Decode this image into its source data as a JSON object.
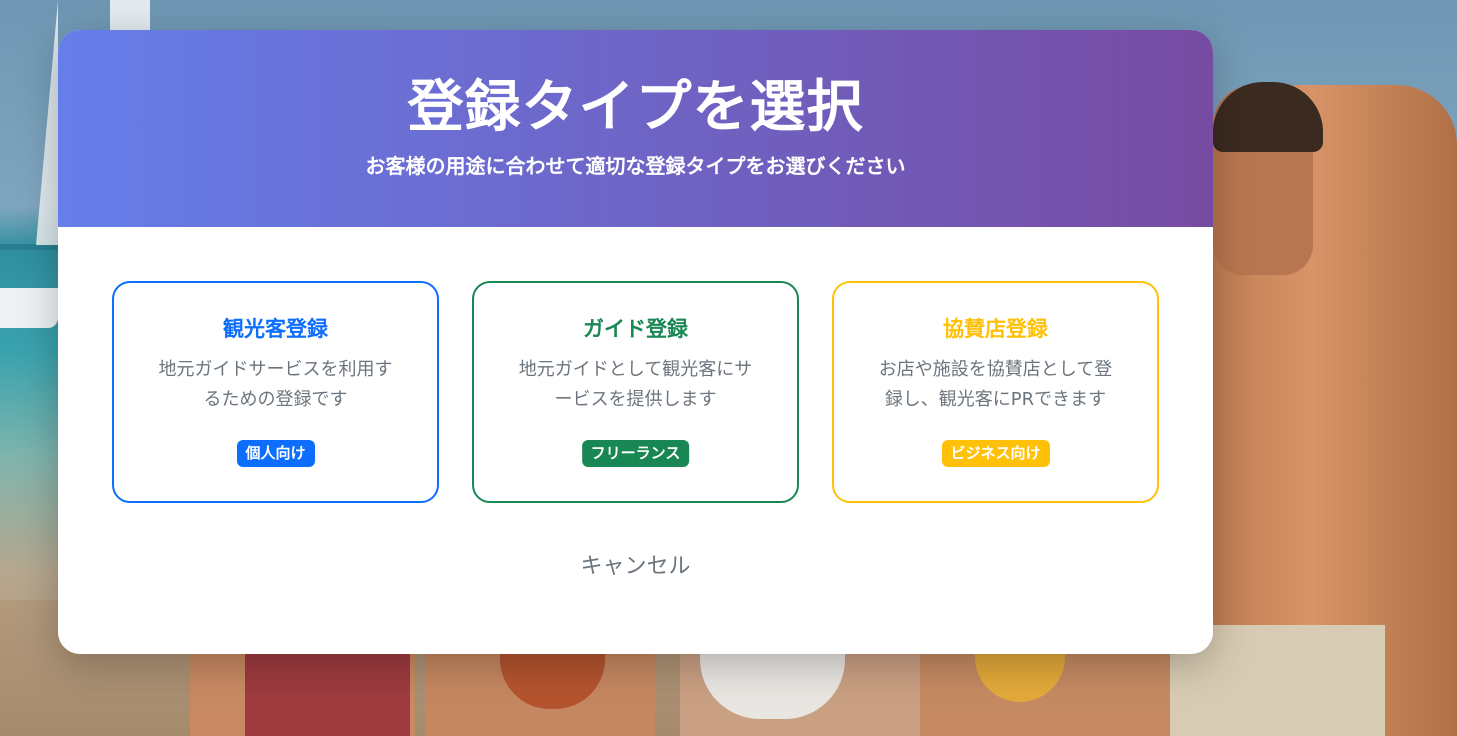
{
  "modal": {
    "title": "登録タイプを選択",
    "subtitle": "お客様の用途に合わせて適切な登録タイプをお選びください",
    "cancel_label": "キャンセル"
  },
  "options": [
    {
      "title": "観光客登録",
      "description": "地元ガイドサービスを利用するための登録です",
      "badge": "個人向け",
      "color": "#0d6efd"
    },
    {
      "title": "ガイド登録",
      "description": "地元ガイドとして観光客にサービスを提供します",
      "badge": "フリーランス",
      "color": "#198754"
    },
    {
      "title": "協賛店登録",
      "description": "お店や施設を協賛店として登録し、観光客にPRできます",
      "badge": "ビジネス向け",
      "color": "#ffc107"
    }
  ],
  "colors": {
    "header_gradient_start": "#667eea",
    "header_gradient_end": "#764ba2",
    "muted_text": "#6c757d"
  }
}
